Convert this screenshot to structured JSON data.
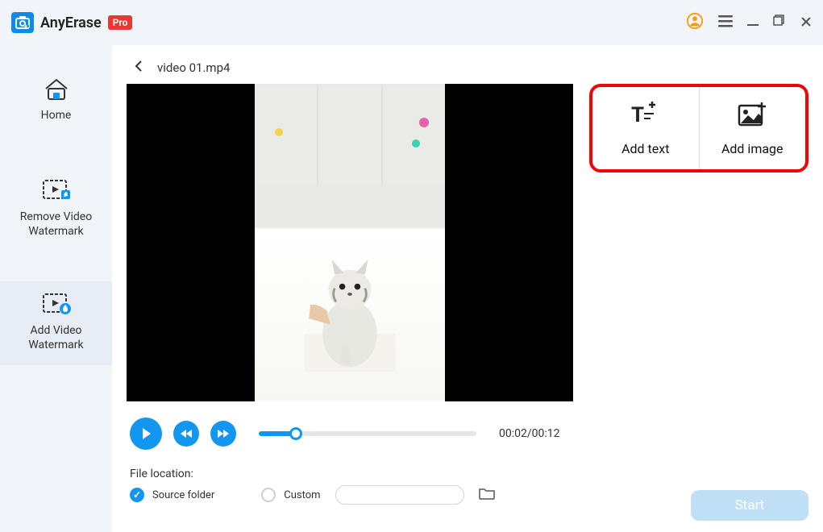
{
  "titlebar": {
    "app_name": "AnyErase",
    "pro_label": "Pro"
  },
  "sidebar": {
    "items": [
      {
        "label": "Home"
      },
      {
        "label": "Remove Video Watermark"
      },
      {
        "label": "Add Video Watermark"
      }
    ],
    "active_index": 2
  },
  "file": {
    "name": "video 01.mp4"
  },
  "add_panel": {
    "add_text_label": "Add text",
    "add_image_label": "Add image"
  },
  "player": {
    "current_time": "00:02",
    "total_time": "00:12",
    "time_display": "00:02/00:12",
    "progress_percent": 17
  },
  "file_location": {
    "label": "File location:",
    "options": [
      {
        "label": "Source folder",
        "checked": true
      },
      {
        "label": "Custom",
        "checked": false
      }
    ]
  },
  "start_button_label": "Start",
  "colors": {
    "primary_blue": "#1296f0",
    "highlight_red": "#ef0707",
    "pro_red": "#e53935",
    "user_orange": "#f39c12"
  }
}
